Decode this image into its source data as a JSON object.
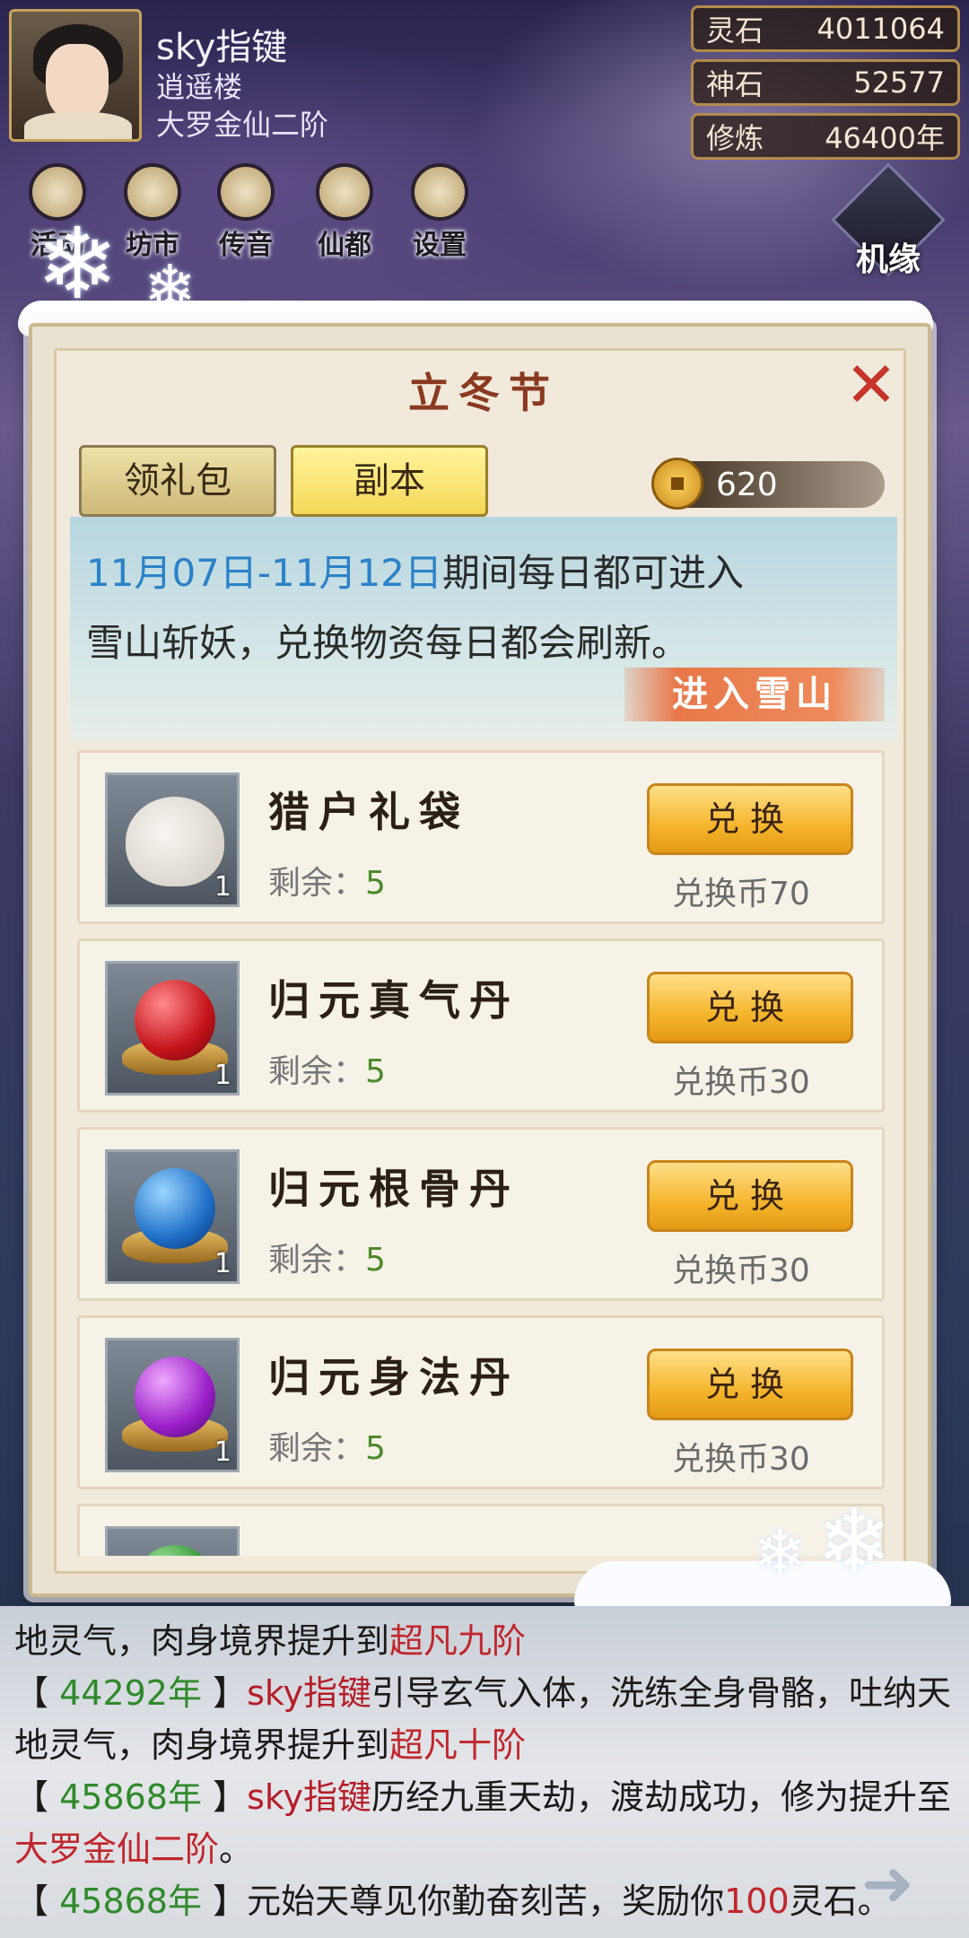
{
  "player": {
    "name": "sky指键",
    "sect": "逍遥楼",
    "rank": "大罗金仙二阶"
  },
  "resources": [
    {
      "label": "灵石",
      "value": "4011064"
    },
    {
      "label": "神石",
      "value": "52577"
    },
    {
      "label": "修炼",
      "value": "46400年"
    }
  ],
  "menu": [
    {
      "label": "活动",
      "icon": "coin-icon"
    },
    {
      "label": "坊市",
      "icon": "market-icon"
    },
    {
      "label": "传音",
      "icon": "mail-icon"
    },
    {
      "label": "仙都",
      "icon": "city-icon"
    },
    {
      "label": "设置",
      "icon": "gear-icon"
    }
  ],
  "jiyuan_label": "机缘",
  "dialog": {
    "title": "立冬节",
    "tabs": [
      "领礼包",
      "副本"
    ],
    "coin_count": "620",
    "banner": {
      "date_range": "11月07日-11月12日",
      "text_after_date": "期间每日都可进入",
      "text_line2": "雪山斩妖，兑换物资每日都会刷新。",
      "enter_button": "进入雪山"
    },
    "items": [
      {
        "name": "猎户礼袋",
        "remain_label": "剩余：",
        "remain": "5",
        "qty": "1",
        "button": "兑换",
        "cost": "兑换币70"
      },
      {
        "name": "归元真气丹",
        "remain_label": "剩余：",
        "remain": "5",
        "qty": "1",
        "button": "兑换",
        "cost": "兑换币30"
      },
      {
        "name": "归元根骨丹",
        "remain_label": "剩余：",
        "remain": "5",
        "qty": "1",
        "button": "兑换",
        "cost": "兑换币30"
      },
      {
        "name": "归元身法丹",
        "remain_label": "剩余：",
        "remain": "5",
        "qty": "1",
        "button": "兑换",
        "cost": "兑换币30"
      }
    ]
  },
  "log": {
    "line1_a": "地灵气，肉身境界提升到",
    "line1_b": "超凡九阶",
    "line2_year": "44292年",
    "line2_name": "sky指键",
    "line2_text": "引导玄气入体，洗练全身骨骼，吐纳天",
    "line3_a": "地灵气，肉身境界提升到",
    "line3_b": "超凡十阶",
    "line4_year": "45868年",
    "line4_name": "sky指键",
    "line4_text": "历经九重天劫，渡劫成功，修为提升至",
    "line5_red": "大罗金仙二阶",
    "line5_tail": "。",
    "line6_year": "45868年",
    "line6_text_a": "元始天尊见你勤奋刻苦，奖励你",
    "line6_num": "100",
    "line6_text_b": "灵石。"
  }
}
